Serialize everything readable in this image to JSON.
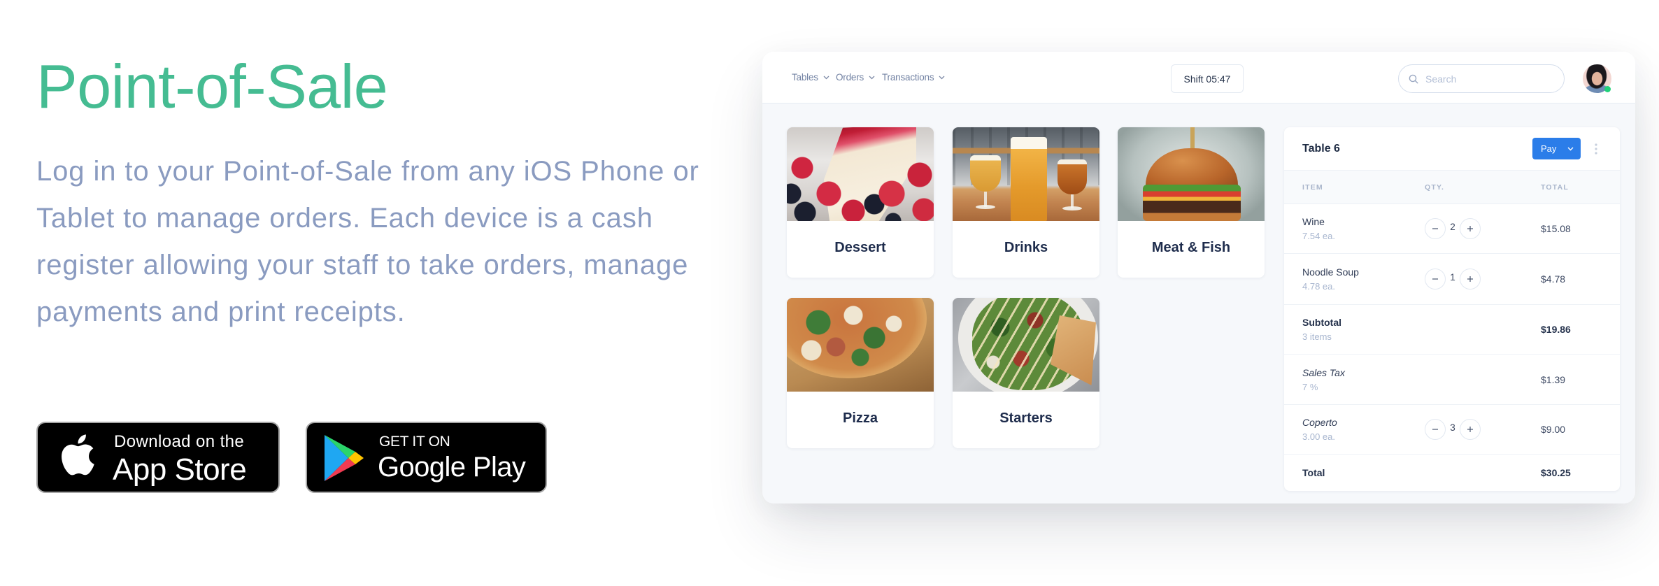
{
  "colors": {
    "accent": "#45bc92",
    "text_muted": "#8a9bc0",
    "pay_button": "#2b7de9",
    "online_status": "#22d17a"
  },
  "hero": {
    "title": "Point-of-Sale",
    "description_lines": [
      "Log in to your Point-of-Sale from any iOS Phone or",
      "Tablet to manage orders. Each device is a cash",
      "register allowing your staff to take orders, manage",
      "payments and print receipts."
    ],
    "badges": [
      {
        "icon": "apple-icon",
        "caption": "Download on the",
        "store": "App Store"
      },
      {
        "icon": "google-play-icon",
        "caption": "GET IT ON",
        "store": "Google Play"
      }
    ]
  },
  "app": {
    "nav": [
      {
        "label": "Tables",
        "icon": "chevron-down-icon"
      },
      {
        "label": "Orders",
        "icon": "chevron-down-icon"
      },
      {
        "label": "Transactions",
        "icon": "chevron-down-icon"
      }
    ],
    "shift": {
      "label": "Shift 05:47"
    },
    "search": {
      "placeholder": "Search",
      "value": "",
      "icon": "search-icon"
    },
    "user": {
      "status": "online"
    },
    "categories": [
      {
        "label": "Dessert",
        "image": "cheesecake slice with raspberries and blueberries"
      },
      {
        "label": "Drinks",
        "image": "three glasses of beer"
      },
      {
        "label": "Meat & Fish",
        "image": "burger"
      },
      {
        "label": "Pizza",
        "image": "pizza with arugula and parmesan"
      },
      {
        "label": "Starters",
        "image": "salad with pita"
      }
    ],
    "order": {
      "title": "Table 6",
      "pay_label": "Pay",
      "columns": {
        "item": "ITEM",
        "qty": "QTY.",
        "total": "TOTAL"
      },
      "lines": [
        {
          "name": "Wine",
          "detail": "7.54 ea.",
          "qty": "2",
          "total": "$15.08"
        },
        {
          "name": "Noodle Soup",
          "detail": "4.78 ea.",
          "qty": "1",
          "total": "$4.78"
        }
      ],
      "subtotal": {
        "label": "Subtotal",
        "detail": "3 items",
        "total": "$19.86"
      },
      "tax": {
        "label": "Sales Tax",
        "detail": "7 %",
        "total": "$1.39"
      },
      "cover_charge": {
        "label": "Coperto",
        "detail": "3.00 ea.",
        "qty": "3",
        "total": "$9.00"
      },
      "grand_total": {
        "label": "Total",
        "total": "$30.25"
      }
    }
  }
}
